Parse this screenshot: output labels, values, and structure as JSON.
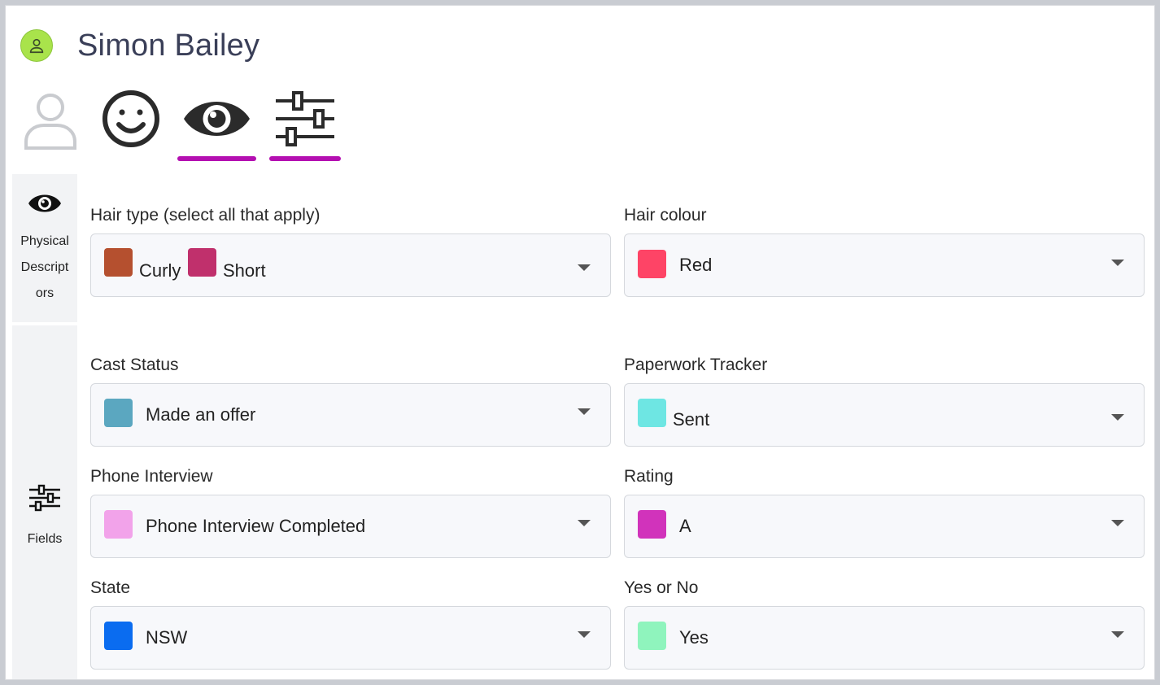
{
  "profile": {
    "name": "Simon Bailey",
    "avatar_color": "#a9e34b"
  },
  "tabs": [
    {
      "icon": "person-icon",
      "active": false
    },
    {
      "icon": "smiley-icon",
      "active": false
    },
    {
      "icon": "eye-icon",
      "active": true
    },
    {
      "icon": "sliders-icon",
      "active": true
    }
  ],
  "sidebar": {
    "items": [
      {
        "icon": "eye-icon",
        "label_lines": [
          "Physical",
          "Descript",
          "ors"
        ]
      },
      {
        "icon": "sliders-icon",
        "label": "Fields"
      }
    ]
  },
  "accent_color": "#b40fb1",
  "fields": {
    "hair_type": {
      "label": "Hair type (select all that apply)",
      "values": [
        {
          "text": "Curly",
          "color": "#b5502f"
        },
        {
          "text": "Short",
          "color": "#c0306c"
        }
      ]
    },
    "hair_colour": {
      "label": "Hair colour",
      "value": "Red",
      "color": "#fe4466"
    },
    "cast_status": {
      "label": "Cast Status",
      "value": "Made an offer",
      "color": "#5ba7c0"
    },
    "paperwork": {
      "label": "Paperwork Tracker",
      "value": "Sent",
      "color": "#6ee6e3"
    },
    "phone_interview": {
      "label": "Phone Interview",
      "value": "Phone Interview Completed",
      "color": "#f2a3ea"
    },
    "rating": {
      "label": "Rating",
      "value": "A",
      "color": "#d133bb"
    },
    "state": {
      "label": "State",
      "value": "NSW",
      "color": "#0a6cf0"
    },
    "yes_no": {
      "label": "Yes or No",
      "value": "Yes",
      "color": "#8ff4bd"
    }
  }
}
